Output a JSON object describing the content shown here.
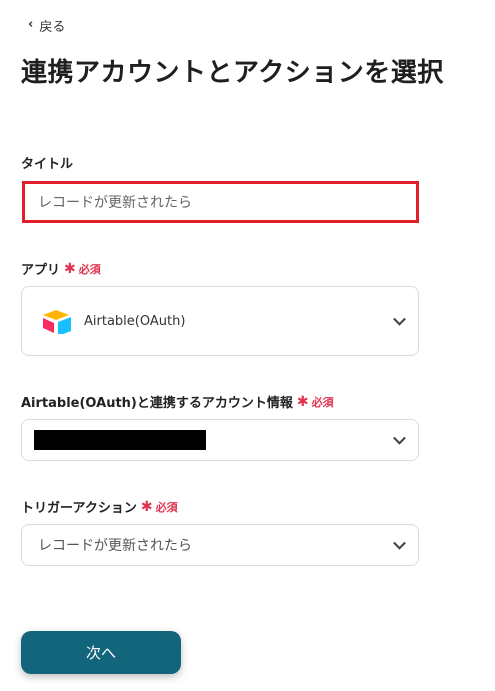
{
  "nav": {
    "back_label": "戻る"
  },
  "page": {
    "title": "連携アカウントとアクションを選択"
  },
  "title_field": {
    "label": "タイトル",
    "value": "レコードが更新されたら"
  },
  "app_field": {
    "label": "アプリ",
    "required": "必須",
    "selected": "Airtable(OAuth)",
    "icon": "airtable-logo-icon"
  },
  "account_field": {
    "label": "Airtable(OAuth)と連携するアカウント情報",
    "required": "必須",
    "selected": "[redacted]"
  },
  "trigger_field": {
    "label": "トリガーアクション",
    "required": "必須",
    "selected": "レコードが更新されたら"
  },
  "next_button": {
    "label": "次へ"
  },
  "colors": {
    "accent": "#12657a",
    "required": "#e0334d",
    "highlight": "#e01f2a"
  }
}
